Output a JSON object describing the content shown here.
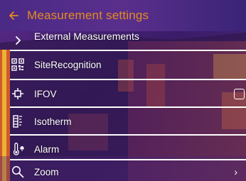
{
  "header": {
    "title": "Measurement settings",
    "back_icon": "back-arrow-icon",
    "title_color": "#e58a22"
  },
  "list": {
    "items": [
      {
        "label": "External Measurements",
        "icon": "chevron-right-icon",
        "control": "none"
      },
      {
        "label": "SiteRecognition",
        "icon": "qr-code-icon",
        "control": "none"
      },
      {
        "label": "IFOV",
        "icon": "crosshair-icon",
        "control": "checkbox",
        "checked": false
      },
      {
        "label": "Isotherm",
        "icon": "isotherm-scale-icon",
        "control": "none"
      },
      {
        "label": "Alarm",
        "icon": "thermometer-alarm-icon",
        "control": "none"
      },
      {
        "label": "Zoom",
        "icon": "magnifier-icon",
        "control": "chevron"
      }
    ],
    "chevron_glyph": "›"
  }
}
